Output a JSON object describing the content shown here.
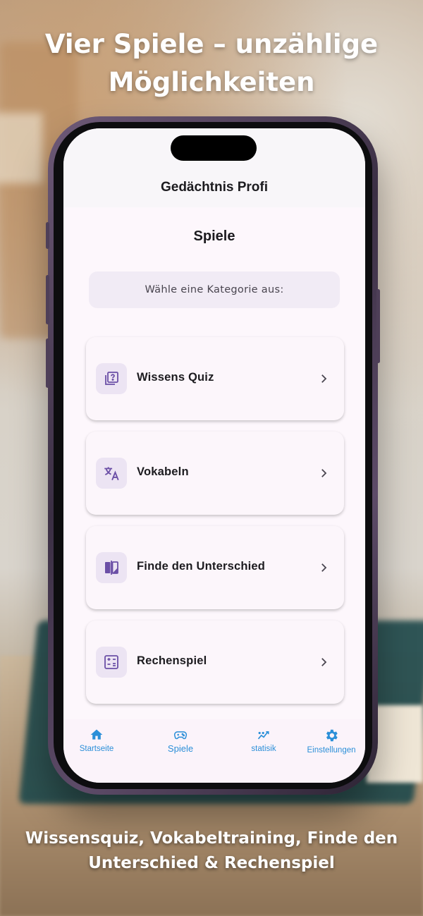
{
  "marketing": {
    "headline_line1": "Vier Spiele – unzählige",
    "headline_line2": "Möglichkeiten",
    "subline_line1": "Wissensquiz, Vokabeltraining, Finde den",
    "subline_line2": "Unterschied & Rechenspiel"
  },
  "app": {
    "title": "Gedächtnis Profi",
    "page_title": "Spiele",
    "category_prompt": "Wähle eine Kategorie aus:"
  },
  "games": [
    {
      "label": "Wissens Quiz",
      "icon": "quiz-icon"
    },
    {
      "label": "Vokabeln",
      "icon": "translate-icon"
    },
    {
      "label": "Finde den Unterschied",
      "icon": "compare-icon"
    },
    {
      "label": "Rechenspiel",
      "icon": "calculator-icon"
    }
  ],
  "nav": {
    "items": [
      {
        "label": "Startseite",
        "icon": "home-icon"
      },
      {
        "label": "Spiele",
        "icon": "gamepad-icon",
        "active": true
      },
      {
        "label": "statisik",
        "icon": "stats-icon"
      },
      {
        "label": "Einstellungen",
        "icon": "gear-icon"
      }
    ]
  },
  "colors": {
    "accent": "#2b8fd8",
    "icon_purple": "#6b4fa6",
    "card_bg": "#fcf6fb",
    "icon_bg": "#ece4f3"
  }
}
